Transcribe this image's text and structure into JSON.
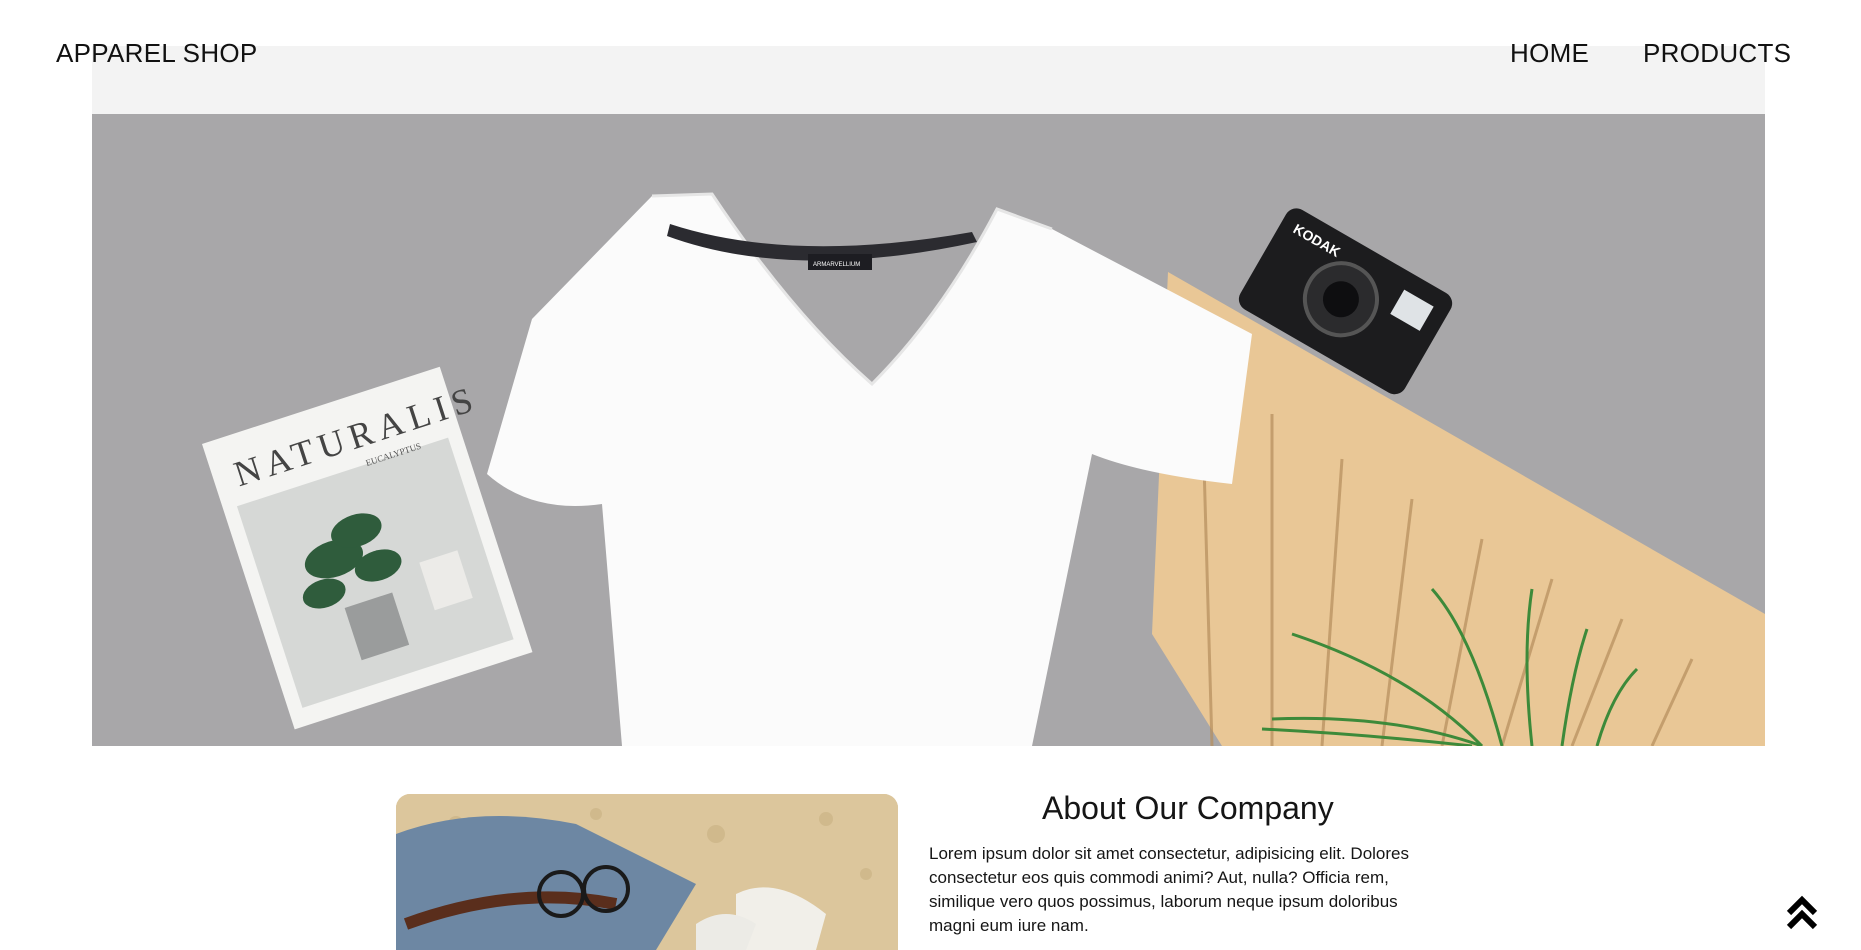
{
  "header": {
    "brand": "APPAREL SHOP",
    "nav": [
      {
        "label": "HOME"
      },
      {
        "label": "PRODUCTS"
      }
    ]
  },
  "hero": {
    "magazine_title": "NATURALIS",
    "magazine_subtitle": "EUCALYPTUS",
    "camera_brand": "KODAK",
    "shirt_label": "ARMARVELLIUM"
  },
  "about": {
    "title": "About Our Company",
    "text": "Lorem ipsum dolor sit amet consectetur, adipisicing elit. Dolores consectetur eos quis commodi animi? Aut, nulla? Officia rem, similique vero quos possimus, laborum neque ipsum doloribus magni eum iure nam."
  },
  "icons": {
    "back_to_top": "double-chevron-up-icon"
  },
  "colors": {
    "background": "#ffffff",
    "band": "#f3f3f3",
    "hero_backdrop": "#a9a8aa",
    "text": "#111111"
  }
}
